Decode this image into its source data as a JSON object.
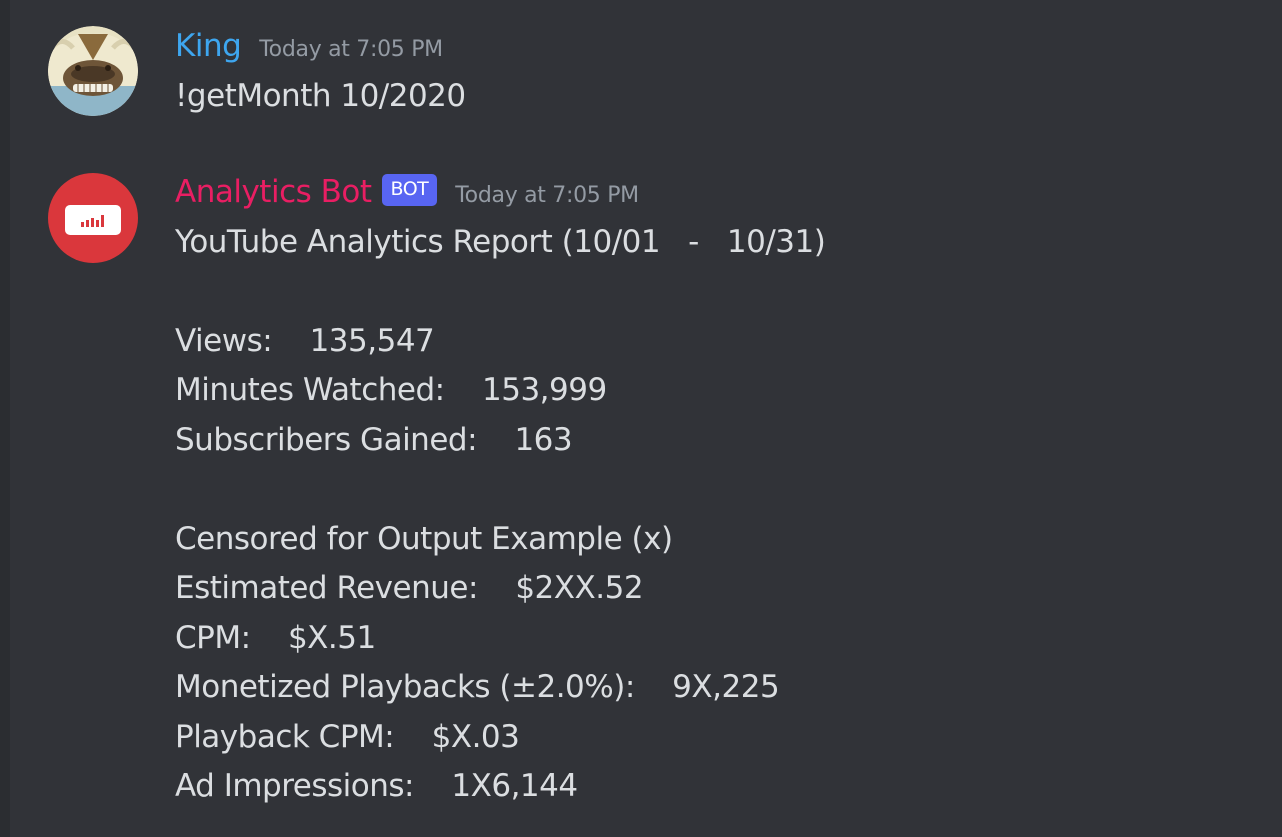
{
  "messages": [
    {
      "username": "King",
      "username_color": "#3ea6ef",
      "timestamp": "Today at 7:05 PM",
      "avatar_icon": "appa-sky-bison-avatar",
      "content": "!getMonth 10/2020"
    },
    {
      "username": "Analytics Bot",
      "username_color": "#e91e63",
      "bot_tag": "BOT",
      "timestamp": "Today at 7:05 PM",
      "avatar_icon": "analytics-bar-chart-avatar",
      "report_title": "YouTube Analytics Report (10/01   -   10/31)",
      "stats": [
        "Views:    135,547",
        "Minutes Watched:    153,999",
        "Subscribers Gained:    163"
      ],
      "censored_note": "Censored for Output Example (x)",
      "revenue_stats": [
        "Estimated Revenue:    $2XX.52",
        "CPM:    $X.51",
        "Monetized Playbacks (±2.0%):    9X,225",
        "Playback CPM:    $X.03",
        "Ad Impressions:    1X6,144"
      ]
    }
  ],
  "colors": {
    "background": "#313338",
    "text": "#dbdee1",
    "timestamp": "#949ba4",
    "bot_tag": "#5865f2",
    "bot_avatar": "#da373c"
  }
}
